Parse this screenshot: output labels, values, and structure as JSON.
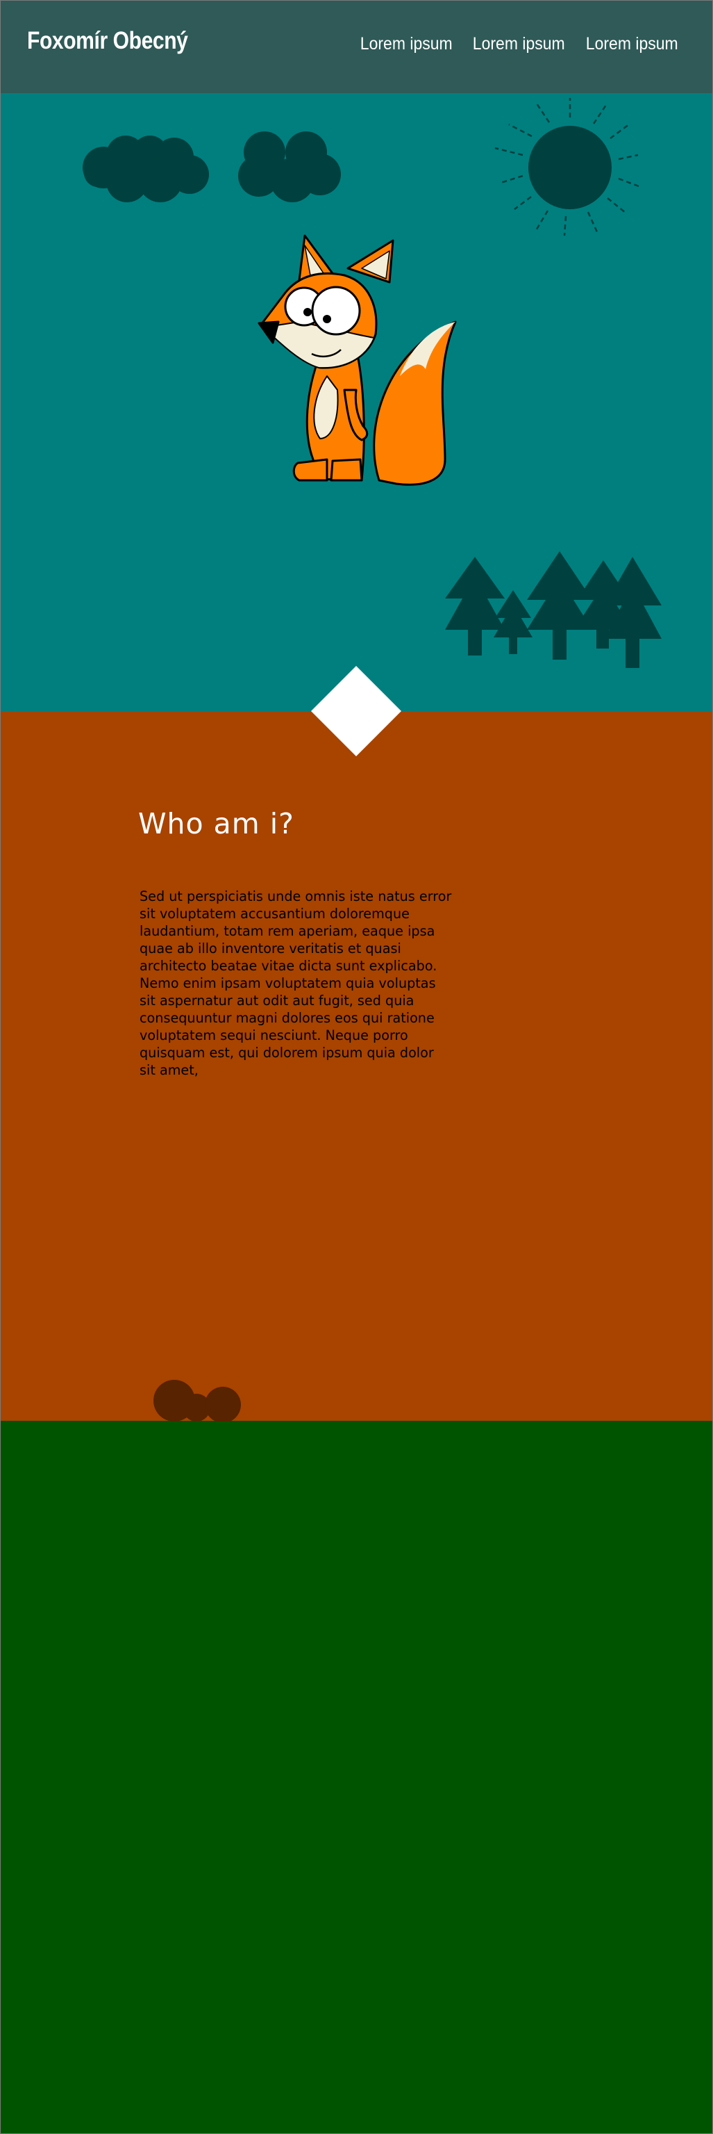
{
  "header": {
    "brand": "Foxomír Obecný",
    "nav": [
      "Lorem ipsum",
      "Lorem ipsum",
      "Lorem ipsum"
    ]
  },
  "about": {
    "title": "Who am i?",
    "text": "Sed ut perspiciatis unde omnis iste natus error sit voluptatem accusantium doloremque laudantium, totam rem aperiam, eaque ipsa quae ab illo inventore veritatis et quasi architecto beatae vitae dicta sunt explicabo. Nemo enim ipsam voluptatem quia voluptas sit aspernatur aut odit aut fugit, sed quia consequuntur magni dolores eos qui ratione voluptatem sequi nesciunt. Neque porro quisquam est, qui dolorem ipsum quia dolor sit amet,"
  },
  "colors": {
    "header": "#2f5a57",
    "sky": "#007f7f",
    "scenery": "#00413f",
    "ground": "#a84300",
    "grass": "#005400",
    "fox": "#ff8000"
  },
  "icons": [
    "cloud-icon",
    "sun-icon",
    "fox-mascot",
    "tree-icon",
    "diamond-icon",
    "bush-icon"
  ]
}
